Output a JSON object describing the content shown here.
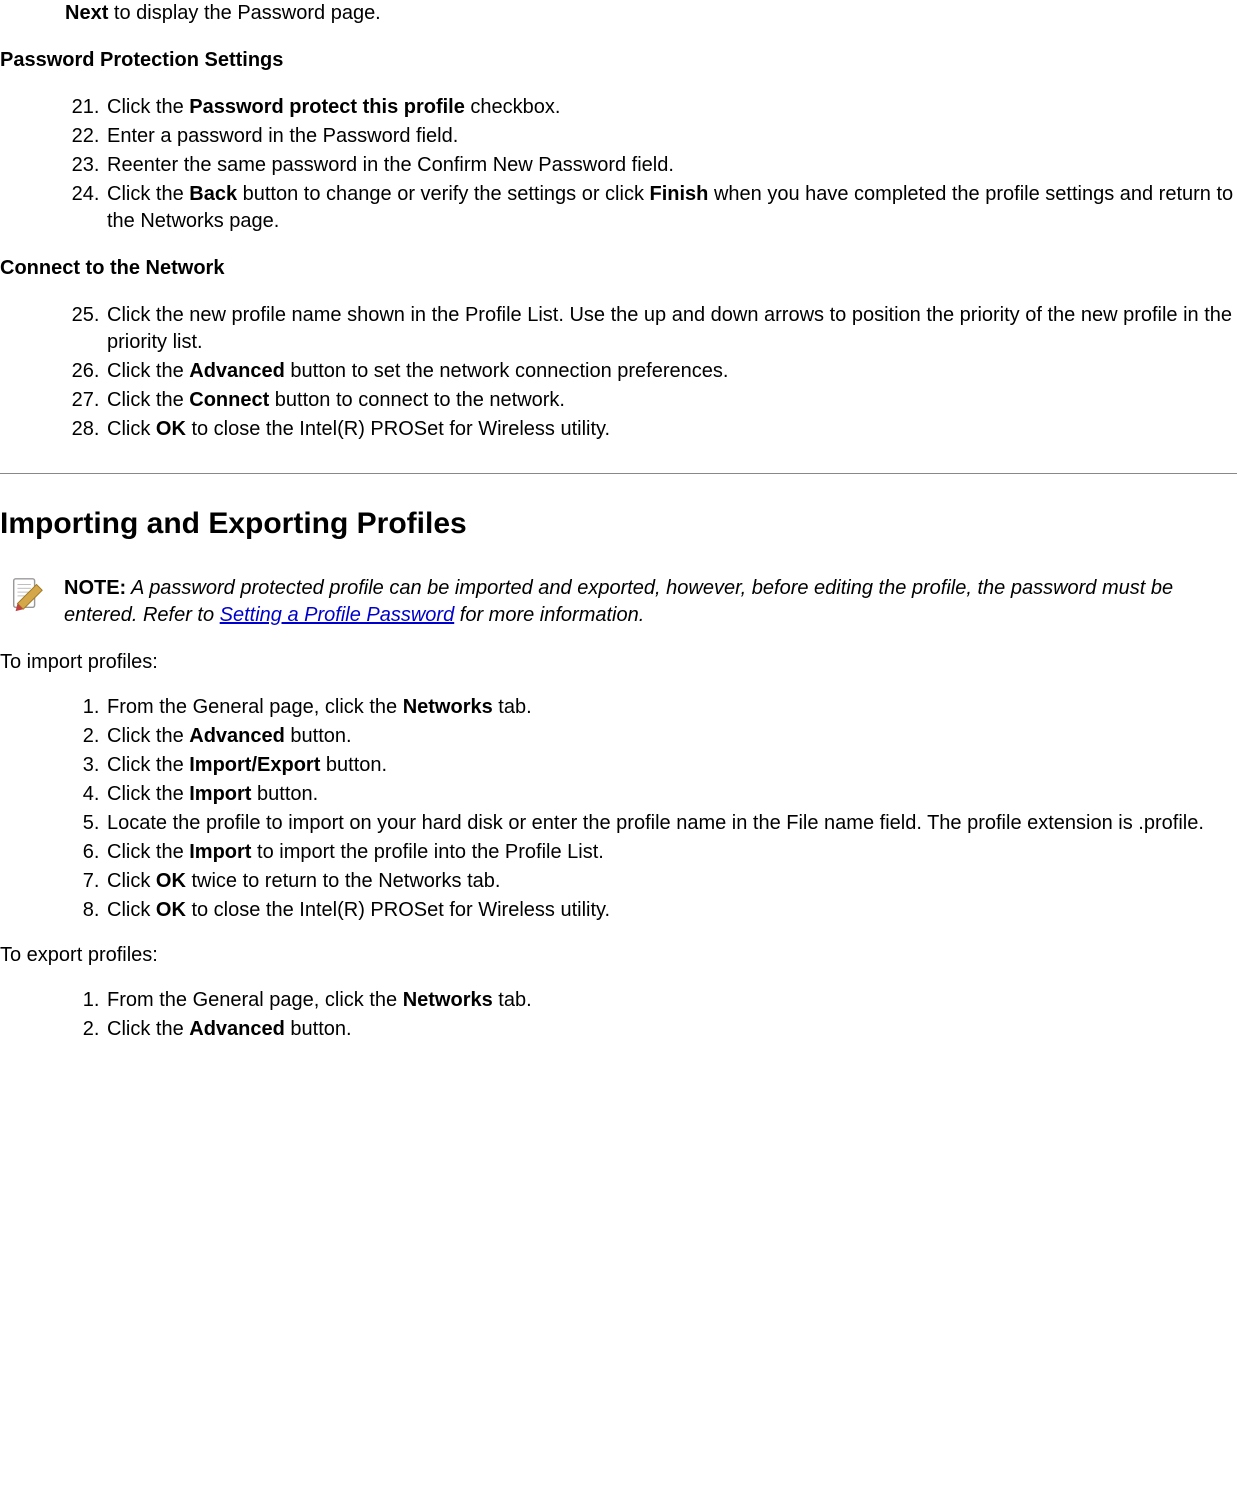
{
  "topLine": {
    "bold": "Next",
    "rest": " to display the Password page."
  },
  "section1": {
    "heading": "Password Protection Settings",
    "start": 21,
    "items": [
      {
        "pre": "Click the ",
        "b1": "Password protect this profile",
        "rest": " checkbox."
      },
      {
        "pre": "Enter a password in the Password field."
      },
      {
        "pre": "Reenter the same password in the Confirm New Password field."
      },
      {
        "pre": "Click the ",
        "b1": "Back",
        "mid": " button to change or verify the settings or click ",
        "b2": "Finish",
        "rest": " when you have completed the profile settings and return to the Networks page."
      }
    ]
  },
  "section2": {
    "heading": "Connect to the Network",
    "start": 25,
    "items": [
      {
        "pre": "Click the new profile name shown in the Profile List. Use the up and down arrows to position the priority of the new profile in the priority list."
      },
      {
        "pre": "Click the ",
        "b1": "Advanced",
        "rest": " button to set the network connection preferences."
      },
      {
        "pre": "Click the ",
        "b1": "Connect",
        "rest": " button to connect to the network."
      },
      {
        "pre": "Click ",
        "b1": "OK",
        "rest": " to close the Intel(R) PROSet for Wireless utility."
      }
    ]
  },
  "importSection": {
    "title": "Importing and Exporting Profiles",
    "note": {
      "label": "NOTE:",
      "pre": " A password protected profile can be imported and exported, however, before editing the profile, the password must be entered. Refer to ",
      "link": "Setting a Profile Password",
      "post": " for more information."
    },
    "importIntro": "To import profiles:",
    "importStart": 1,
    "importItems": [
      {
        "pre": "From the General page, click the ",
        "b1": "Networks",
        "rest": " tab."
      },
      {
        "pre": "Click the ",
        "b1": "Advanced",
        "rest": " button."
      },
      {
        "pre": "Click the ",
        "b1": "Import/Export",
        "rest": " button."
      },
      {
        "pre": "Click the ",
        "b1": "Import",
        "rest": " button."
      },
      {
        "pre": "Locate the profile to import on your hard disk or enter the profile name in the File name field. The profile extension is .profile."
      },
      {
        "pre": "Click the ",
        "b1": "Import",
        "rest": " to import the profile into the Profile List."
      },
      {
        "pre": "Click ",
        "b1": "OK",
        "rest": " twice to return to the Networks tab."
      },
      {
        "pre": "Click ",
        "b1": "OK",
        "rest": " to close the Intel(R) PROSet for Wireless utility."
      }
    ],
    "exportIntro": "To export profiles:",
    "exportStart": 1,
    "exportItems": [
      {
        "pre": "From the General page, click the ",
        "b1": "Networks",
        "rest": " tab."
      },
      {
        "pre": "Click the ",
        "b1": "Advanced",
        "rest": " button."
      }
    ]
  }
}
